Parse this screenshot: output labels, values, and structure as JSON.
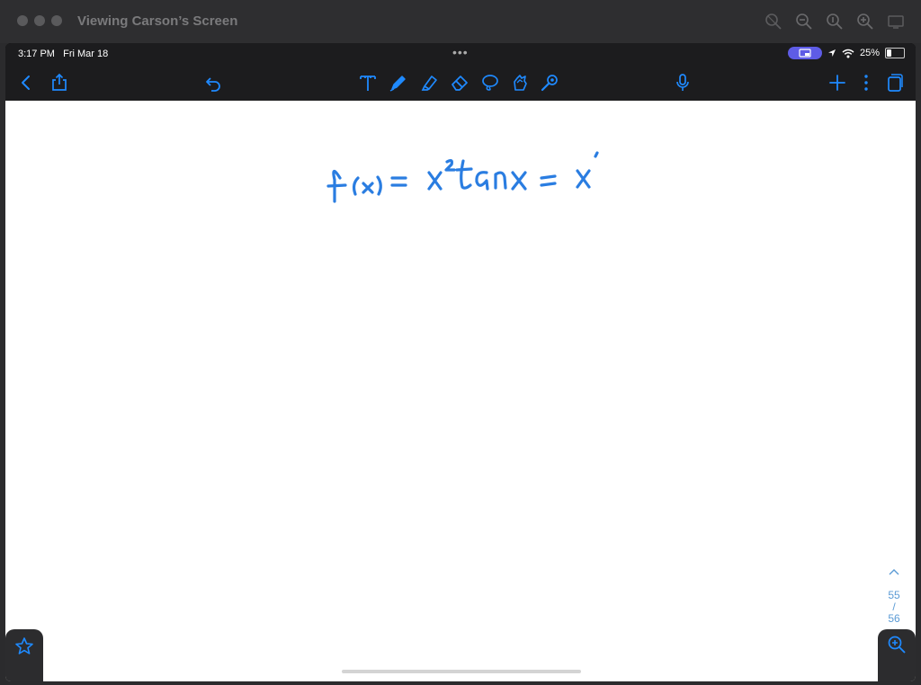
{
  "window": {
    "title": "Viewing Carson’s Screen"
  },
  "status_bar": {
    "time": "3:17 PM",
    "date": "Fri Mar 18",
    "battery": "25%",
    "battery_fraction": 0.25
  },
  "page_nav": {
    "current": "55",
    "separator": "/",
    "total": "56"
  },
  "colors": {
    "accent": "#1f8aff",
    "ink": "#2a7de1",
    "toolbar": "#1c1c1e",
    "pager": "#5b9bd5"
  }
}
